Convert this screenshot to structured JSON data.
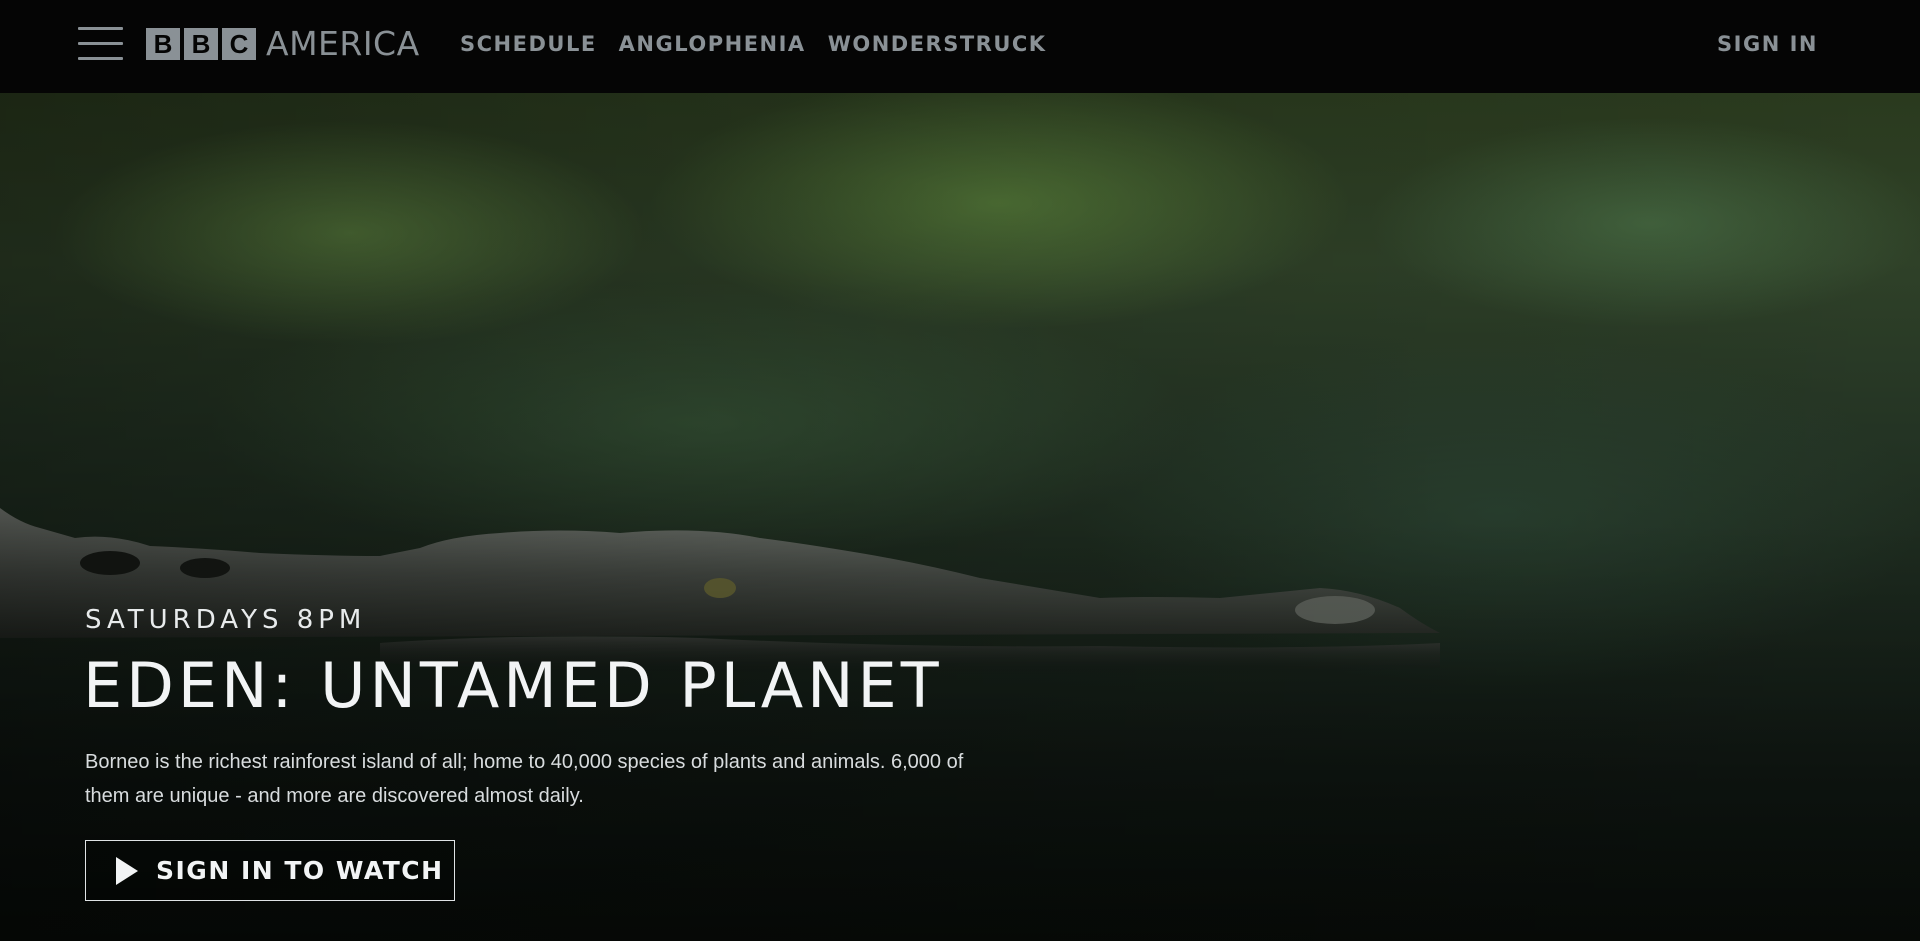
{
  "header": {
    "logo": {
      "blocks": [
        "B",
        "B",
        "C"
      ],
      "word": "AMERICA"
    },
    "nav": [
      {
        "label": "SCHEDULE"
      },
      {
        "label": "ANGLOPHENIA"
      },
      {
        "label": "WONDERSTRUCK"
      }
    ],
    "sign_in": "SIGN IN",
    "icons": {
      "menu": "hamburger-menu-icon"
    }
  },
  "hero": {
    "schedule": "SATURDAYS 8PM",
    "title": "EDEN: UNTAMED PLANET",
    "description": "Borneo is the richest rainforest island of all; home to 40,000 species of plants and animals. 6,000 of them are unique - and more are discovered almost daily.",
    "cta": {
      "label": "SIGN IN TO WATCH",
      "icon": "play-icon"
    },
    "image_subject": "crocodile-in-water"
  },
  "colors": {
    "header_bg": "#050505",
    "header_text": "#8a9196",
    "hero_text": "#f2f4f5"
  }
}
